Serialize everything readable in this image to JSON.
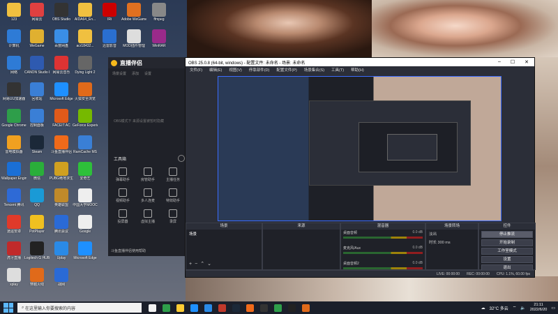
{
  "desktop": {
    "icons": [
      {
        "label": "123",
        "color": "#f0c040"
      },
      {
        "label": "网易云",
        "color": "#e04040"
      },
      {
        "label": "OBS Studio",
        "color": "#333"
      },
      {
        "label": "AIDA64_En...",
        "color": "#f0c040"
      },
      {
        "label": "IRi",
        "color": "#c00"
      },
      {
        "label": "Adobe WeGame",
        "color": "#e07020"
      },
      {
        "label": "ffmpeg",
        "color": "#888"
      },
      {
        "label": "计算机",
        "color": "#2e7bd6"
      },
      {
        "label": "WeGame",
        "color": "#e0b030"
      },
      {
        "label": "百度网盘",
        "color": "#3a8ee6"
      },
      {
        "label": "acr18432...",
        "color": "#f0c040"
      },
      {
        "label": "迅雷影音",
        "color": "#2a6fd0"
      },
      {
        "label": "MOD插件管理",
        "color": "#ddd"
      },
      {
        "label": "WinRAR",
        "color": "#9a2a8a"
      },
      {
        "label": "网络",
        "color": "#2e7bd6"
      },
      {
        "label": "CANON Studio Lite",
        "color": "#2e5ab0"
      },
      {
        "label": "网易云音乐",
        "color": "#d33"
      },
      {
        "label": "Dying Light 2",
        "color": "#666"
      },
      {
        "label": "网易UU加速器",
        "color": "#333"
      },
      {
        "label": "回收站",
        "color": "#3a7fd6"
      },
      {
        "label": "Microsoft Edge",
        "color": "#1e90ff"
      },
      {
        "label": "火狐安全浏览",
        "color": "#e06a1a"
      },
      {
        "label": "Google Chrome",
        "color": "#2e9e4a"
      },
      {
        "label": "控制面板",
        "color": "#3a7fd6"
      },
      {
        "label": "FACEIT AC",
        "color": "#e05a1a"
      },
      {
        "label": "GeForce Experience",
        "color": "#76b900"
      },
      {
        "label": "雷电模拟器",
        "color": "#f0a020"
      },
      {
        "label": "Steam",
        "color": "#1b2838"
      },
      {
        "label": "斗鱼直播伴侣",
        "color": "#f06a1a"
      },
      {
        "label": "RamCache MS",
        "color": "#3a7fd6"
      },
      {
        "label": "Wallpaper Engine",
        "color": "#1a6fd6"
      },
      {
        "label": "微信",
        "color": "#2aae3a"
      },
      {
        "label": "PUBG绝地求生",
        "color": "#d0a020"
      },
      {
        "label": "爱奇艺",
        "color": "#2ec03a"
      },
      {
        "label": "Tencent 腾讯",
        "color": "#2e6ad6"
      },
      {
        "label": "QQ",
        "color": "#1a9ad6"
      },
      {
        "label": "英雄联盟",
        "color": "#c08a2a"
      },
      {
        "label": "中国大学MOOC",
        "color": "#eee"
      },
      {
        "label": "逍遥安卓",
        "color": "#e03a2a"
      },
      {
        "label": "PotPlayer",
        "color": "#f0c020"
      },
      {
        "label": "腾讯会议",
        "color": "#2a6ad6"
      },
      {
        "label": "Google",
        "color": "#eee"
      },
      {
        "label": "虎牙直播",
        "color": "#c02a2a"
      },
      {
        "label": "Logitech G HUB",
        "color": "#222"
      },
      {
        "label": "Uplay",
        "color": "#2a8ae6"
      },
      {
        "label": "Microsoft Edge",
        "color": "#1e90ff"
      },
      {
        "label": "xplay",
        "color": "#ddd"
      },
      {
        "label": "穿越火线",
        "color": "#e06a1a"
      },
      {
        "label": "战网",
        "color": "#2a6ad6"
      }
    ]
  },
  "stream_app": {
    "logo": "直播伴侣",
    "tabs": [
      "场景设置",
      "添加",
      "设置"
    ],
    "empty_text": "OBS模式下 来源设置被暂时隐藏",
    "toolbox_title": "工具箱",
    "tools": [
      "弹幕助手",
      "房管助手",
      "主播任务",
      "视频助手",
      "多人连麦",
      "特效助手",
      "投屏器",
      "虚拟主播",
      "录屏"
    ],
    "ad_text": "斗鱼直播伴侣使用帮助"
  },
  "obs": {
    "title": "OBS 25.0.8 (64-bit, windows) - 配置文件: 未命名 - 场景: 未命名",
    "menu": [
      "文件(F)",
      "编辑(E)",
      "视图(V)",
      "停靠部件(D)",
      "配置文件(P)",
      "场景集合(S)",
      "工具(T)",
      "帮助(H)"
    ],
    "docks": {
      "scenes": {
        "title": "场景",
        "items": [
          "场景"
        ]
      },
      "sources": {
        "title": "来源"
      },
      "mixer": {
        "title": "混音器",
        "channels": [
          {
            "name": "桌面音频",
            "db": "0.0 dB"
          },
          {
            "name": "麦克风/Aux",
            "db": "0.0 dB"
          },
          {
            "name": "桌面音频2",
            "db": "0.0 dB"
          }
        ]
      },
      "transitions": {
        "title": "场景转场",
        "type": "淡出",
        "duration_label": "时长",
        "duration": "300 ms"
      },
      "controls": {
        "title": "控件",
        "buttons": [
          "停止推流",
          "开始录制",
          "工作室模式",
          "设置",
          "退出"
        ]
      }
    },
    "status": {
      "live": "LIVE: 00:00:00",
      "rec": "REC: 00:00:00",
      "cpu": "CPU: 1.1%, 60.00 fps"
    }
  },
  "taskbar": {
    "search_placeholder": "在这里输入你要搜索的内容",
    "weather": "32°C 多云",
    "time": "21:11",
    "date": "2022/6/20",
    "pinned": [
      "#f2f2f2",
      "#2e9e4a",
      "#ffcc33",
      "#1e90ff",
      "#2a8ae6",
      "#c0392b",
      "#1b2838",
      "#f06a1a",
      "#333",
      "#2e9e4a",
      "#222",
      "#e06a1a"
    ]
  }
}
